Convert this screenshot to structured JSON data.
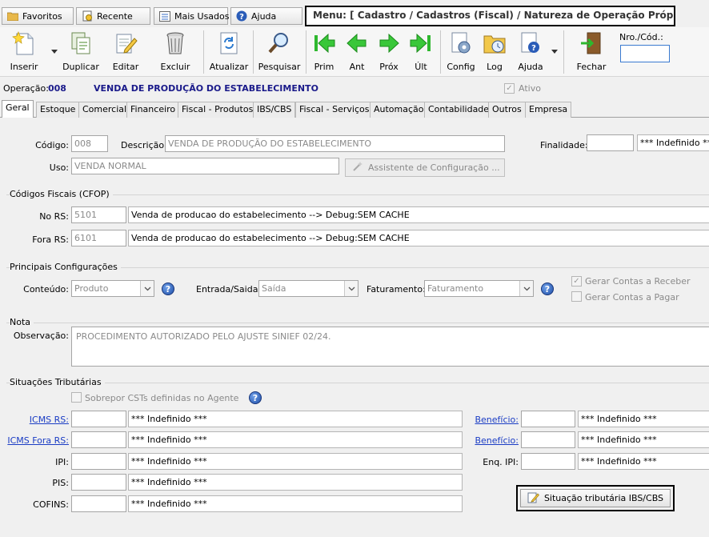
{
  "favbar": {
    "favoritos": "Favoritos",
    "recente": "Recente",
    "mais_usados": "Mais Usados",
    "ajuda": "Ajuda",
    "menu_path": "Menu: [ Cadastro / Cadastros (Fiscal) / Natureza de Operação Próprio]"
  },
  "toolbar": {
    "inserir": "Inserir",
    "duplicar": "Duplicar",
    "editar": "Editar",
    "excluir": "Excluir",
    "atualizar": "Atualizar",
    "pesquisar": "Pesquisar",
    "prim": "Prim",
    "ant": "Ant",
    "prox": "Próx",
    "ult": "Últ",
    "config": "Config",
    "log": "Log",
    "ajuda": "Ajuda",
    "fechar": "Fechar",
    "nro_label": "Nro./Cód.:",
    "nro_value": ""
  },
  "operation": {
    "label": "Operação:",
    "code": "008",
    "name": "VENDA DE PRODUÇÃO DO ESTABELECIMENTO",
    "ativo_label": "Ativo"
  },
  "tabs": [
    "Geral",
    "Estoque",
    "Comercial",
    "Financeiro",
    "Fiscal - Produtos",
    "IBS/CBS",
    "Fiscal - Serviços",
    "Automação",
    "Contabilidade",
    "Outros",
    "Empresa"
  ],
  "general": {
    "codigo_label": "Código:",
    "codigo_value": "008",
    "descricao_label": "Descrição:",
    "descricao_value": "VENDA DE PRODUÇÃO DO ESTABELECIMENTO",
    "finalidade_label": "Finalidade:",
    "finalidade_value": "",
    "finalidade_desc": "*** Indefinido **",
    "uso_label": "Uso:",
    "uso_value": "VENDA NORMAL",
    "assistente_label": "Assistente de Configuração ..."
  },
  "cfop": {
    "title": "Códigos Fiscais (CFOP)",
    "no_rs_label": "No RS:",
    "no_rs_code": "5101",
    "no_rs_desc": "Venda de producao do estabelecimento   --> Debug:SEM CACHE",
    "fora_rs_label": "Fora RS:",
    "fora_rs_code": "6101",
    "fora_rs_desc": "Venda de producao do estabelecimento   --> Debug:SEM CACHE"
  },
  "config": {
    "title": "Principais Configurações",
    "conteudo_label": "Conteúdo:",
    "conteudo_value": "Produto",
    "entrada_saida_label": "Entrada/Saida:",
    "entrada_saida_value": "Saída",
    "faturamento_label": "Faturamento:",
    "faturamento_value": "Faturamento",
    "gerar_receber_label": "Gerar Contas a Receber",
    "gerar_receber_checked": true,
    "gerar_pagar_label": "Gerar Contas a Pagar",
    "gerar_pagar_checked": false
  },
  "nota": {
    "title": "Nota",
    "obs_label": "Observação:",
    "obs_value": "PROCEDIMENTO AUTORIZADO PELO AJUSTE SINIEF 02/24."
  },
  "situacoes": {
    "title": "Situações Tributárias",
    "sobrepor_label": "Sobrepor CSTs definidas no Agente",
    "icms_rs_label": "ICMS RS:",
    "icms_rs_desc": "*** Indefinido ***",
    "icms_fora_label": "ICMS Fora RS:",
    "icms_fora_desc": "*** Indefinido ***",
    "ipi_label": "IPI:",
    "ipi_desc": "*** Indefinido ***",
    "pis_label": "PIS:",
    "pis_desc": "*** Indefinido ***",
    "cofins_label": "COFINS:",
    "cofins_desc": "*** Indefinido ***",
    "beneficio1_label": "Benefício:",
    "beneficio1_desc": "*** Indefinido ***",
    "beneficio2_label": "Benefício:",
    "beneficio2_desc": "*** Indefinido ***",
    "enq_ipi_label": "Enq. IPI:",
    "enq_ipi_desc": "*** Indefinido ***",
    "ibs_button": "Situação tributária IBS/CBS"
  }
}
